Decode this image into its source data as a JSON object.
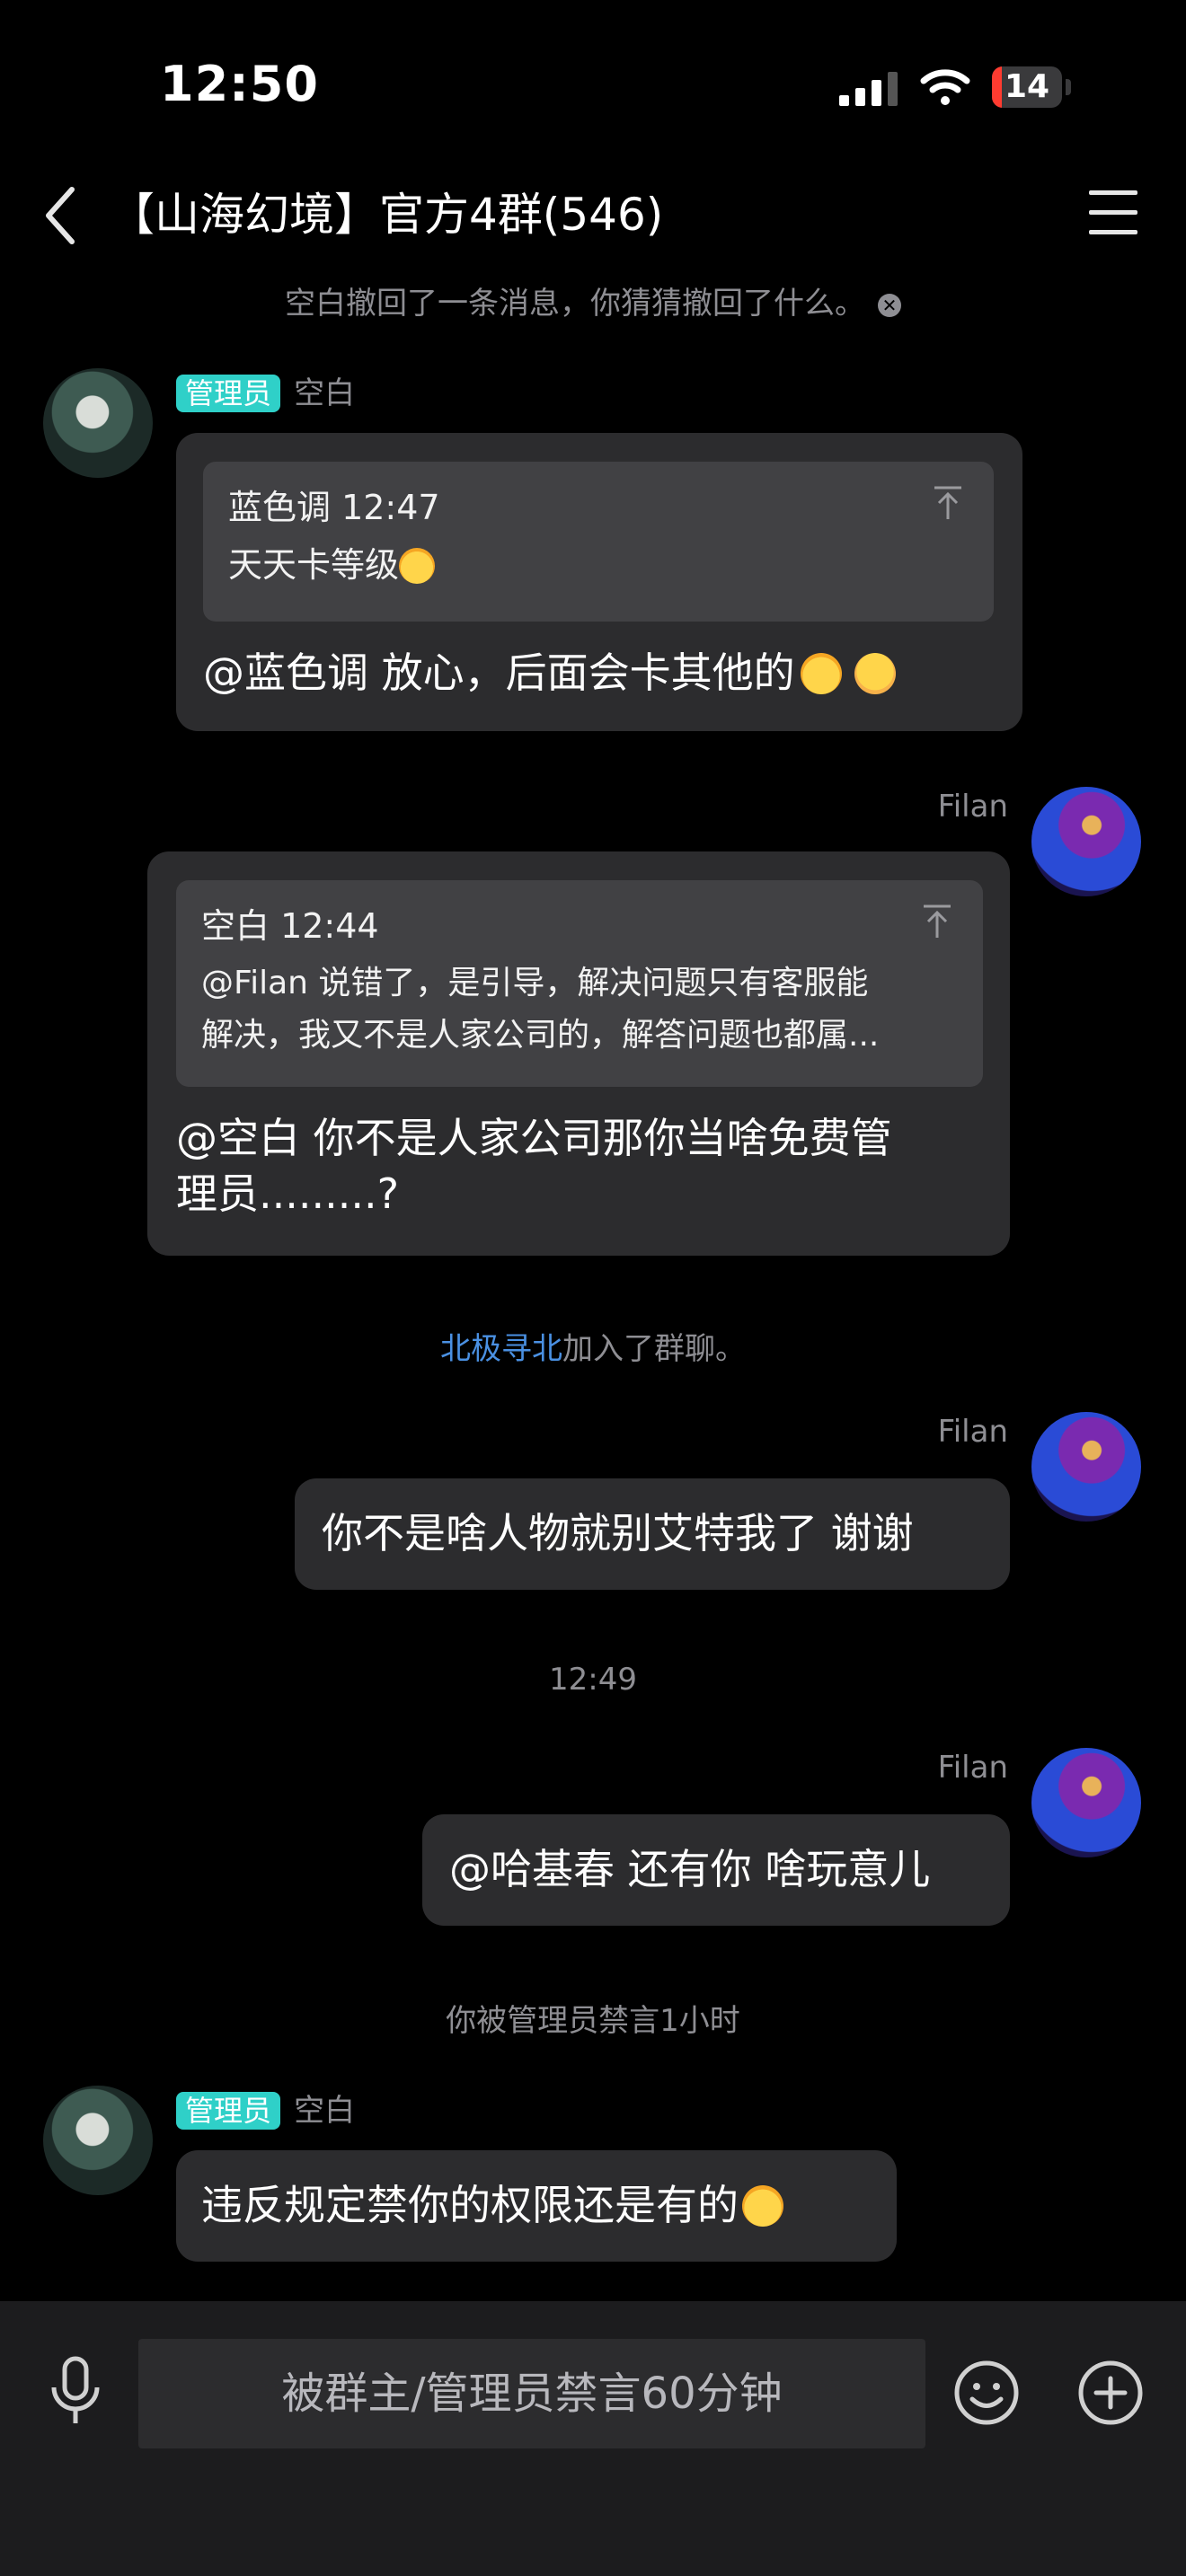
{
  "status_bar": {
    "time": "12:50",
    "battery": "14"
  },
  "header": {
    "title": "【山海幻境】官方4群(546)"
  },
  "messages": {
    "recall_notice": "空白撤回了一条消息，你猜猜撤回了什么。",
    "m1": {
      "badge": "管理员",
      "sender": "空白",
      "quote_header": "蓝色调 12:47",
      "quote_text": "天天卡等级",
      "text": "@蓝色调 放心，后面会卡其他的"
    },
    "m2": {
      "sender": "Filan",
      "quote_header": "空白 12:44",
      "quote_line1": "@Filan 说错了，是引导，解决问题只有客服能",
      "quote_line2": "解决，我又不是人家公司的，解答问题也都属...",
      "line1": "@空白 你不是人家公司那你当啥免费管",
      "line2": "理员.........?"
    },
    "join_name": "北极寻北",
    "join_suffix": "加入了群聊。",
    "m3": {
      "sender": "Filan",
      "text": "你不是啥人物就别艾特我了 谢谢"
    },
    "timestamp": "12:49",
    "m4": {
      "sender": "Filan",
      "text": "@哈基春 还有你 啥玩意儿"
    },
    "mute_notice": "你被管理员禁言1小时",
    "m5": {
      "badge": "管理员",
      "sender": "空白",
      "text": "违反规定禁你的权限还是有的"
    }
  },
  "input_bar": {
    "placeholder": "被群主/管理员禁言60分钟"
  },
  "icons": [
    "signal-icon",
    "wifi-icon",
    "battery-icon",
    "back-chevron-icon",
    "menu-icon",
    "pin-top-icon",
    "mic-icon",
    "smile-icon",
    "plus-icon"
  ],
  "colors": {
    "accent_badge": "#2fd0c8",
    "link": "#4a90e2",
    "battery_low": "#ff3b30",
    "bubble": "#2c2c2e"
  }
}
